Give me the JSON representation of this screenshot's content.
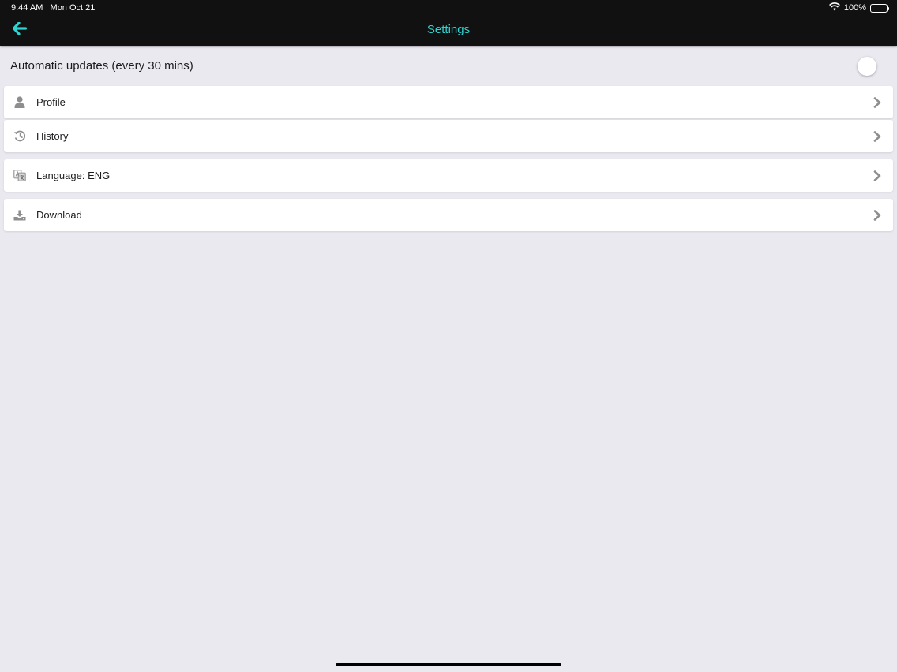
{
  "status_bar": {
    "time": "9:44 AM",
    "date": "Mon Oct 21",
    "battery": "100%"
  },
  "header": {
    "title": "Settings",
    "back_icon": "arrow-left-icon"
  },
  "auto_update": {
    "label": "Automatic updates (every 30 mins)",
    "enabled": false
  },
  "menu": {
    "items": [
      {
        "label": "Profile",
        "icon": "user-icon"
      },
      {
        "label": "History",
        "icon": "history-icon"
      },
      {
        "label": "Language: ENG",
        "icon": "translate-icon"
      },
      {
        "label": "Download",
        "icon": "download-icon"
      }
    ]
  },
  "colors": {
    "accent": "#2fd4d0",
    "header_bg": "#111111",
    "page_bg": "#ebe9f0",
    "icon_gray": "#8e8e8e"
  }
}
